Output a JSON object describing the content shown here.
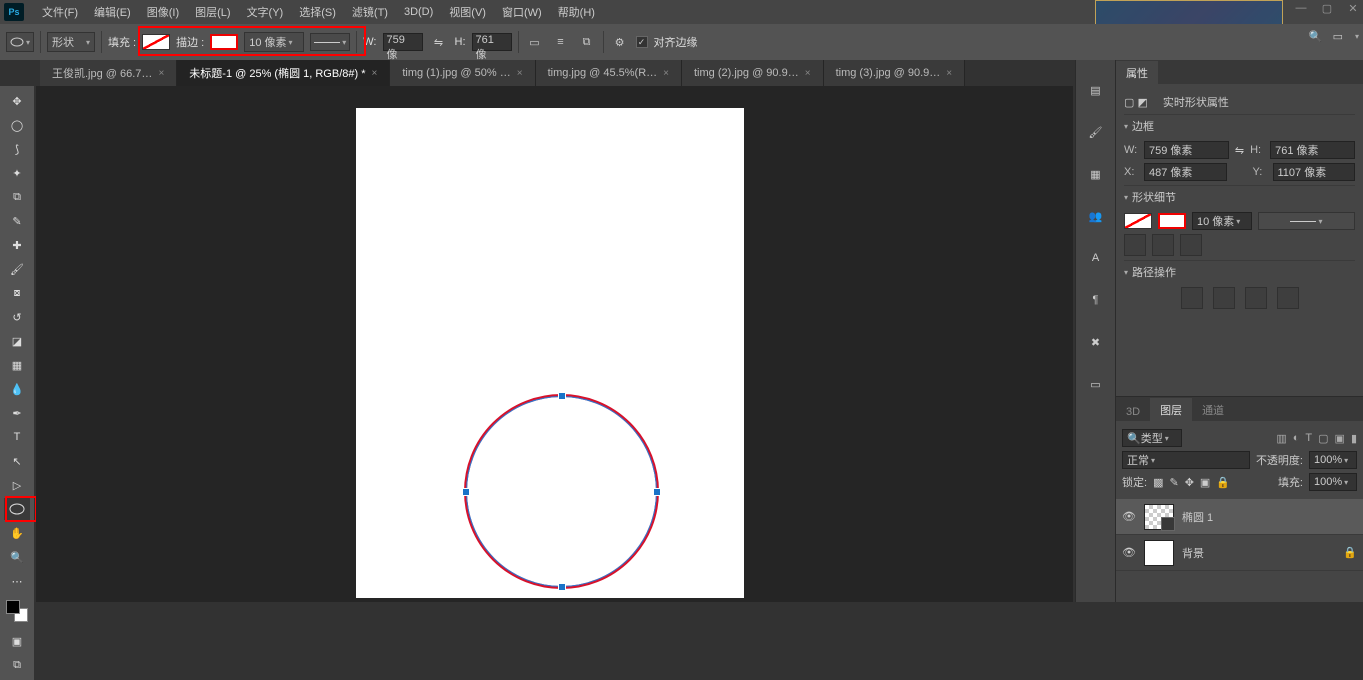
{
  "menu": {
    "items": [
      "文件(F)",
      "编辑(E)",
      "图像(I)",
      "图层(L)",
      "文字(Y)",
      "选择(S)",
      "滤镜(T)",
      "3D(D)",
      "视图(V)",
      "窗口(W)",
      "帮助(H)"
    ],
    "logo": "Ps"
  },
  "opts": {
    "shape": "形状",
    "fill_label": "填充 :",
    "stroke_label": "描边 :",
    "stroke_size": "10 像素",
    "w_label": "W:",
    "w_val": "759 像",
    "h_label": "H:",
    "h_val": "761 像",
    "align_label": "对齐边缘"
  },
  "tabs": [
    {
      "label": "王俊凯.jpg @ 66.7…",
      "active": false
    },
    {
      "label": "未标题-1 @ 25% (椭圆 1, RGB/8#) *",
      "active": true
    },
    {
      "label": "timg (1).jpg @ 50% …",
      "active": false
    },
    {
      "label": "timg.jpg @ 45.5%(R…",
      "active": false
    },
    {
      "label": "timg (2).jpg @ 90.9…",
      "active": false
    },
    {
      "label": "timg (3).jpg @ 90.9…",
      "active": false
    }
  ],
  "panels": {
    "properties_tab": "属性",
    "live_shape": "实时形状属性",
    "bound_section": "边框",
    "w_lbl": "W:",
    "w": "759 像素",
    "h_lbl": "H:",
    "h": "761 像素",
    "x_lbl": "X:",
    "x": "487 像素",
    "y_lbl": "Y:",
    "y": "1107 像素",
    "detail_section": "形状细节",
    "stroke_size": "10 像素",
    "path_section": "路径操作",
    "threeD": "3D",
    "layers": "图层",
    "channels": "通道",
    "kind": "类型",
    "normal": "正常",
    "opacity_lbl": "不透明度:",
    "opacity": "100%",
    "lock_lbl": "锁定:",
    "fill_lbl": "填充:",
    "fill": "100%",
    "layer1": "椭圆 1",
    "layer_bg": "背景"
  }
}
